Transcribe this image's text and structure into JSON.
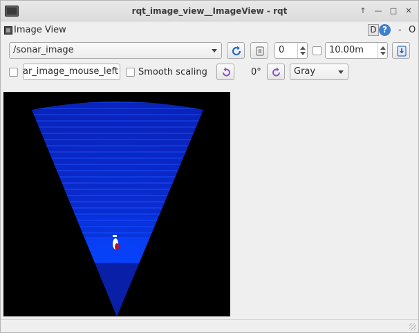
{
  "window": {
    "title": "rqt_image_view__ImageView - rqt"
  },
  "plugin": {
    "title": "Image View",
    "d_button": "D",
    "help_button": "?",
    "minimize": "-",
    "close": "O"
  },
  "toolbar": {
    "topic": "/sonar_image",
    "spin_value": "0",
    "max_range": "10.00m",
    "mouse_topic": "ar_image_mouse_left",
    "smooth_scaling_label": "Smooth scaling",
    "rotation": "0°",
    "colormap": "Gray"
  },
  "icons": {
    "refresh": "refresh-icon",
    "pause": "pause-icon",
    "save": "save-icon",
    "rotate_left": "rotate-left-icon",
    "rotate_right": "rotate-right-icon"
  },
  "colors": {
    "sonar_fan": "#0a2fd6",
    "sonar_near": "#0640ff",
    "background": "#000000"
  }
}
